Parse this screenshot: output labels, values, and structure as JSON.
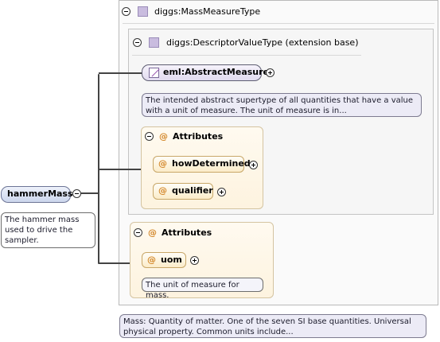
{
  "root": {
    "name": "hammerMass",
    "doc": [
      "The hammer mass",
      "used to drive the",
      "sampler."
    ]
  },
  "mass_type": {
    "title": "diggs:MassMeasureType",
    "doc": [
      "Mass: Quantity of matter. One of the seven SI base quantities. Universal",
      "physical property. Common units include..."
    ]
  },
  "descriptor": {
    "title": "diggs:DescriptorValueType (extension base)",
    "abstract_measure": {
      "name": "eml:AbstractMeasure",
      "doc": [
        "The intended abstract supertype of all quantities that have a value",
        "with a unit of measure. The unit of measure is in..."
      ]
    },
    "attributes": {
      "label": "Attributes",
      "items": [
        "howDetermined",
        "qualifier"
      ]
    }
  },
  "uom_attributes": {
    "label": "Attributes",
    "item": "uom",
    "doc": "The unit of measure for mass."
  },
  "colors": {
    "element_fill": "#ccd6ec",
    "attribute_fill": "#fbecc9",
    "type_icon": "#c9bcdf",
    "connector": "#444444"
  }
}
